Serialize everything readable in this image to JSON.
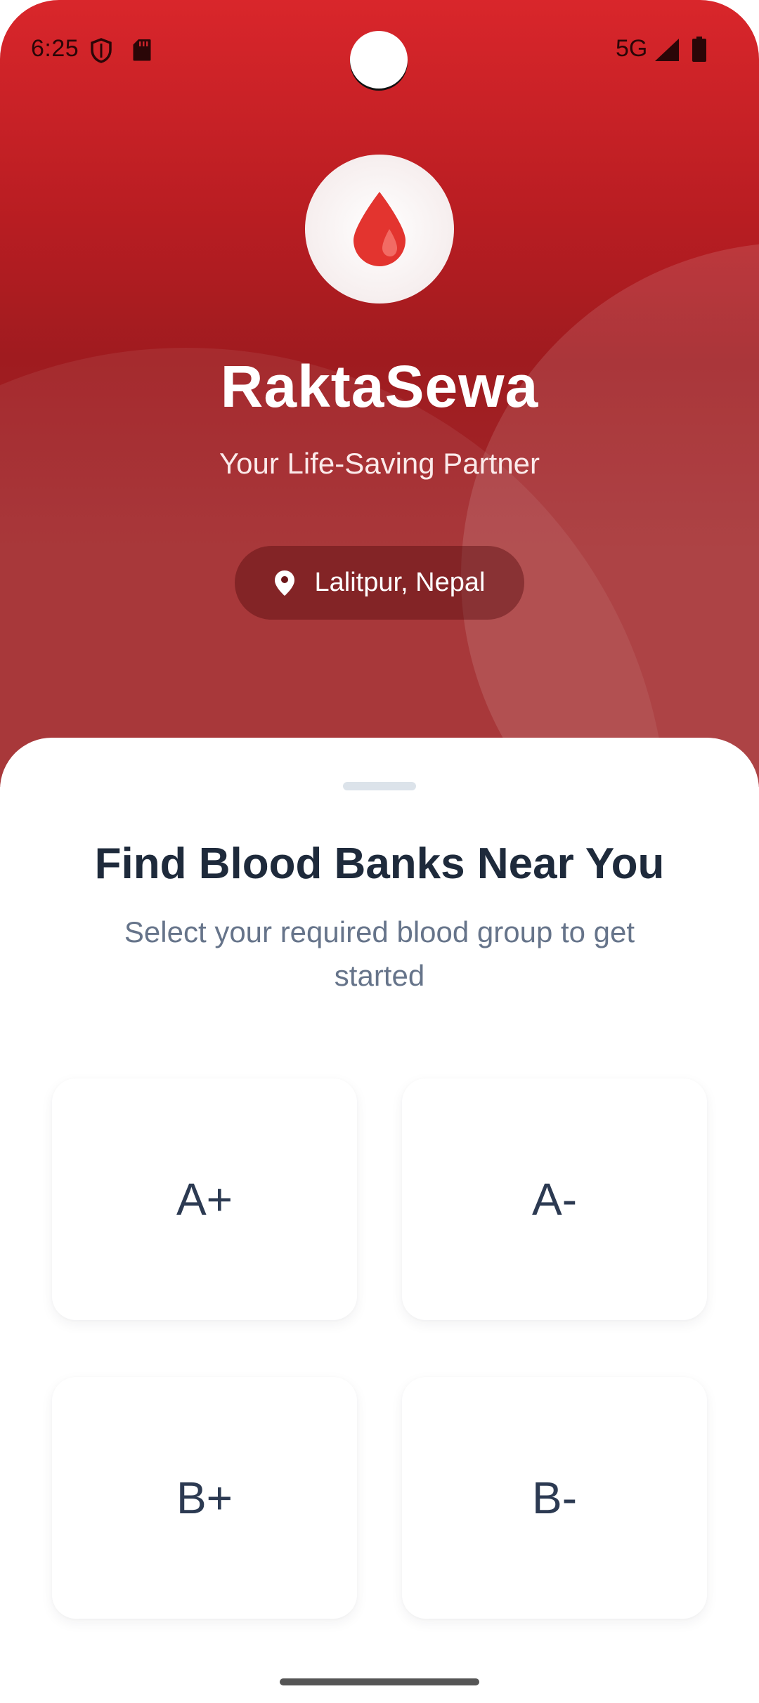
{
  "status_bar": {
    "time": "6:25",
    "network": "5G",
    "icons": [
      "shield-icon",
      "sd-card-icon",
      "signal-icon",
      "battery-icon"
    ]
  },
  "header": {
    "logo_icon": "blood-drop-icon",
    "app_name": "RaktaSewa",
    "tagline": "Your Life-Saving Partner",
    "location_icon": "location-pin-icon",
    "location": "Lalitpur, Nepal"
  },
  "sheet": {
    "title": "Find Blood Banks Near You",
    "subtitle": "Select your required blood group to get started",
    "blood_groups": [
      "A+",
      "A-",
      "B+",
      "B-"
    ]
  },
  "colors": {
    "brand_red": "#d9262b",
    "dark_red": "#9f1b1f",
    "title_text": "#1e2a3b",
    "subtitle_text": "#66748a",
    "card_text": "#2c3a52"
  }
}
